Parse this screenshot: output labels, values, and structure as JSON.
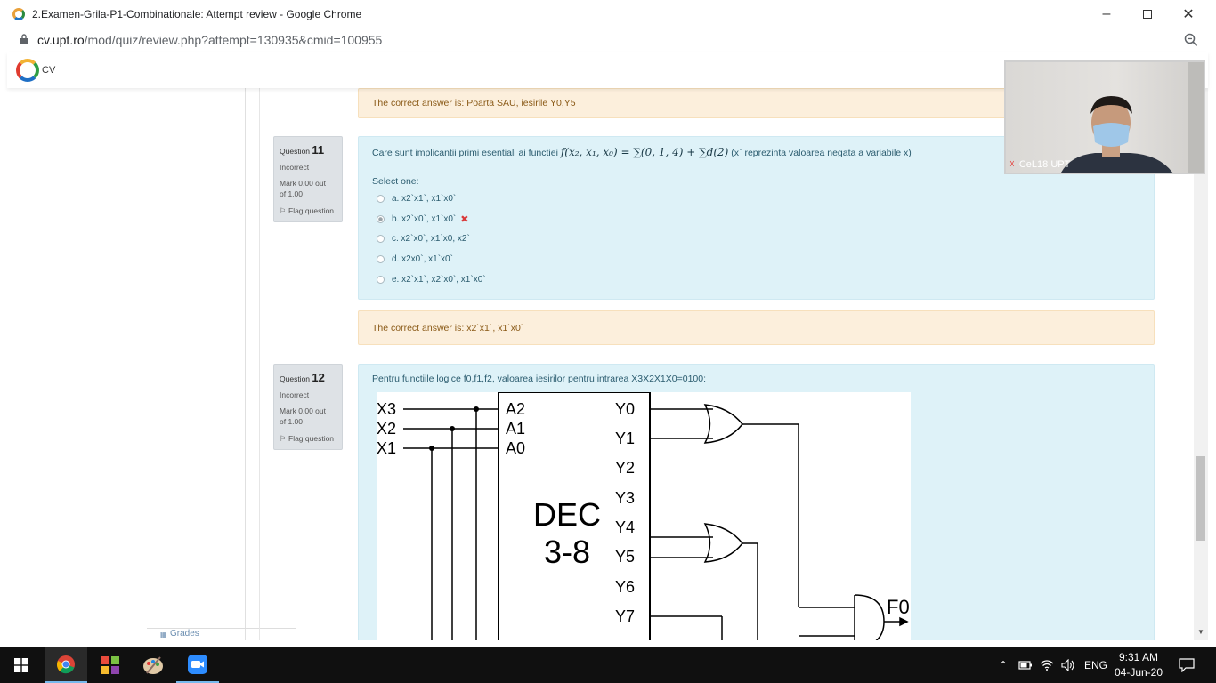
{
  "window": {
    "title": "2.Examen-Grila-P1-Combinationale: Attempt review - Google Chrome",
    "url_host": "cv.upt.ro",
    "url_path": "/mod/quiz/review.php?attempt=130935&cmid=100955"
  },
  "site": {
    "name": "CV"
  },
  "feedback_top": "The correct answer is: Poarta SAU, iesirile Y0,Y5",
  "q11": {
    "question_label": "Question",
    "number": "11",
    "state": "Incorrect",
    "mark_line1": "Mark 0.00 out",
    "mark_line2": "of 1.00",
    "flag_label": "Flag question",
    "text_before": "Care sunt implicantii primi esentiali ai functiei",
    "math": "f(x₂, x₁, x₀) = ∑(0, 1, 4) + ∑d(2)",
    "text_after": "(x` reprezinta valoarea negata a variabile x)",
    "select_one": "Select one:",
    "options": [
      {
        "label": "a. x2`x1`, x1`x0`"
      },
      {
        "label": "b. x2`x0`, x1`x0`"
      },
      {
        "label": "c. x2`x0`, x1`x0, x2`"
      },
      {
        "label": "d. x2x0`, x1`x0`"
      },
      {
        "label": "e. x2`x1`, x2`x0`, x1`x0`"
      }
    ],
    "feedback": "The correct answer is: x2`x1`, x1`x0`"
  },
  "q12": {
    "question_label": "Question",
    "number": "12",
    "state": "Incorrect",
    "mark_line1": "Mark 0.00 out",
    "mark_line2": "of 1.00",
    "flag_label": "Flag question",
    "text": "Pentru functiile logice f0,f1,f2, valoarea iesirilor pentru intrarea X3X2X1X0=0100:",
    "circuit": {
      "inputs": [
        "X3",
        "X2",
        "X1"
      ],
      "decoder_inputs": [
        "A2",
        "A1",
        "A0"
      ],
      "decoder_outputs": [
        "Y0",
        "Y1",
        "Y2",
        "Y3",
        "Y4",
        "Y5",
        "Y6",
        "Y7"
      ],
      "decoder_title_line1": "DEC",
      "decoder_title_line2": "3-8",
      "output_label": "F0"
    }
  },
  "left_nav": {
    "grades": "Grades"
  },
  "video": {
    "participant": "CeL18 UPT"
  },
  "taskbar": {
    "language": "ENG",
    "time": "9:31 AM",
    "date": "04-Jun-20"
  }
}
